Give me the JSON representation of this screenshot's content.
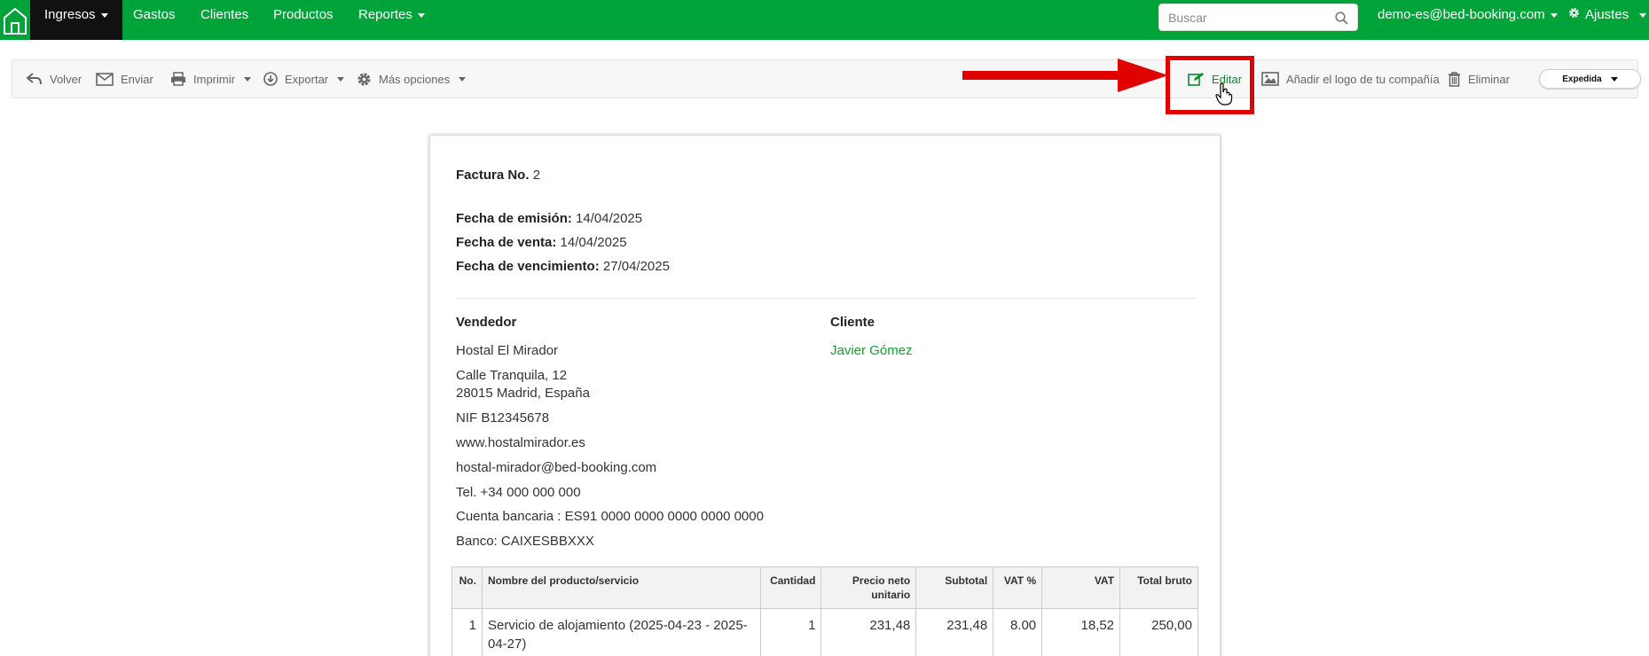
{
  "nav": {
    "items": [
      "Ingresos",
      "Gastos",
      "Clientes",
      "Productos",
      "Reportes"
    ],
    "search_placeholder": "Buscar",
    "user_email": "demo-es@bed-booking.com",
    "settings_label": "Ajustes"
  },
  "toolbar": {
    "back": "Volver",
    "send": "Enviar",
    "print": "Imprimir",
    "export": "Exportar",
    "more": "Más opciones",
    "edit": "Editar",
    "add_logo": "Añadir el logo de tu compañía",
    "delete": "Eliminar",
    "status": "Expedida"
  },
  "invoice": {
    "number_label": "Factura No.",
    "number": "2",
    "issue_label": "Fecha de emisión:",
    "issue_date": "14/04/2025",
    "sale_label": "Fecha de venta:",
    "sale_date": "14/04/2025",
    "due_label": "Fecha de vencimiento:",
    "due_date": "27/04/2025",
    "seller_heading": "Vendedor",
    "client_heading": "Cliente",
    "client_name": "Javier Gómez",
    "seller": {
      "name": "Hostal El Mirador",
      "address1": "Calle Tranquila, 12",
      "address2": "28015 Madrid, España",
      "nif": "NIF B12345678",
      "web": "www.hostalmirador.es",
      "email": "hostal-mirador@bed-booking.com",
      "phone": "Tel. +34 000 000 000",
      "bank_account": "Cuenta bancaria : ES91 0000 0000 0000 0000 0000",
      "bank": "Banco: CAIXESBBXXX"
    },
    "table": {
      "headers": [
        "No.",
        "Nombre del producto/servicio",
        "Cantidad",
        "Precio neto unitario",
        "Subtotal",
        "VAT %",
        "VAT",
        "Total bruto"
      ],
      "rows": [
        [
          "1",
          "Servicio de alojamiento (2025-04-23 - 2025-04-27)",
          "1",
          "231,48",
          "231,48",
          "8.00",
          "18,52",
          "250,00"
        ]
      ]
    }
  },
  "colors": {
    "brand_green": "#00a33a",
    "link_green": "#1a9a36",
    "annotation_red": "#e00000"
  }
}
